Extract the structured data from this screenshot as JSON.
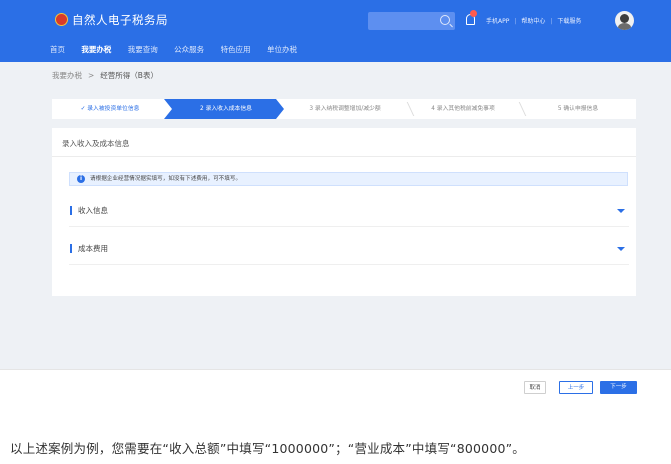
{
  "header": {
    "app_title": "自然人电子税务局",
    "top_links": [
      "手机APP",
      "帮助中心",
      "下载服务"
    ],
    "nav": [
      "首页",
      "我要办税",
      "我要查询",
      "公众服务",
      "特色应用",
      "单位办税"
    ],
    "active_nav_index": 1
  },
  "breadcrumb": {
    "parent": "我要办税",
    "current": "经营所得（B表）"
  },
  "steps": [
    "✓ 录入被投资单位信息",
    "2 录入收入成本信息",
    "3 录入纳税调整增加/减少额",
    "4 录入其他税前减免事项",
    "5 确认申报信息"
  ],
  "active_step_index": 1,
  "card": {
    "title": "录入收入及成本信息",
    "notice": "请根据企业经营情况据实填写，如没有下述费用，可不填写。",
    "sections": [
      "收入信息",
      "成本费用"
    ]
  },
  "footer": {
    "cancel": "取消",
    "prev": "上一步",
    "next": "下一步"
  },
  "caption": "以上述案例为例，您需要在“收入总额”中填写“1000000”；“营业成本”中填写“800000”。",
  "colors": {
    "primary": "#2b6fe6",
    "background": "#eef1f5"
  }
}
